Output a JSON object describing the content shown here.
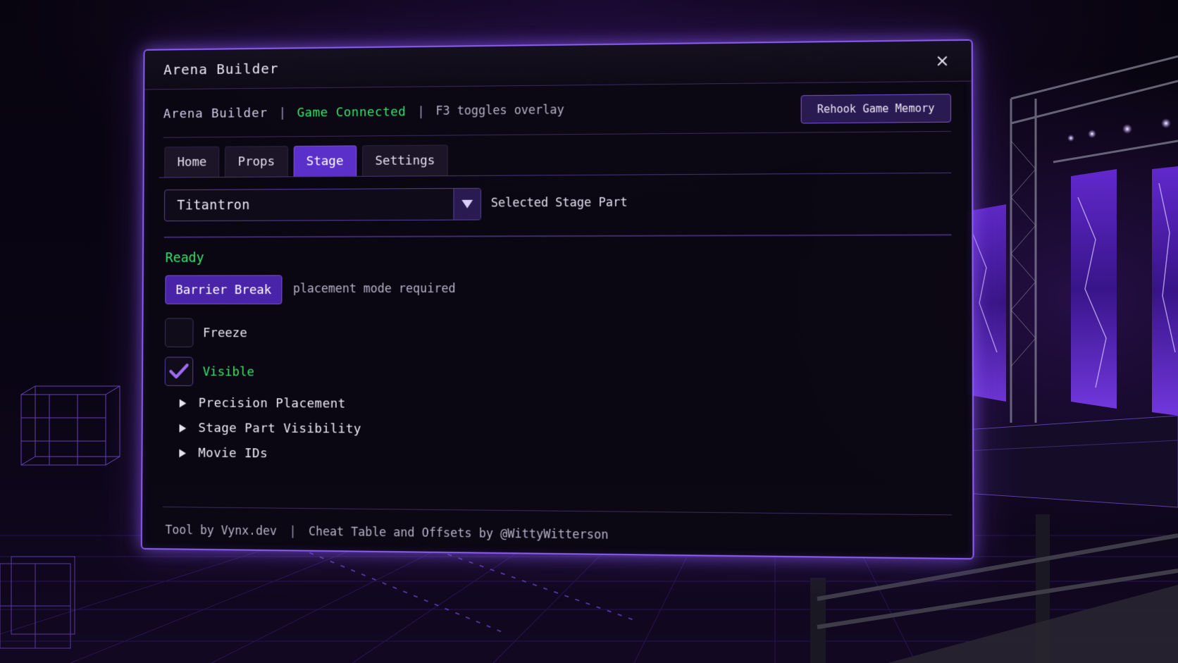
{
  "window": {
    "title": "Arena Builder",
    "close_icon": "close-icon"
  },
  "status": {
    "app_name": "Arena Builder",
    "separator": "|",
    "connection": "Game Connected",
    "hint": "F3 toggles overlay",
    "rehook_label": "Rehook Game Memory"
  },
  "tabs": [
    {
      "label": "Home",
      "active": false
    },
    {
      "label": "Props",
      "active": false
    },
    {
      "label": "Stage",
      "active": true
    },
    {
      "label": "Settings",
      "active": false
    }
  ],
  "stage": {
    "selected_part": "Titantron",
    "selected_part_label": "Selected Stage Part",
    "status": "Ready",
    "barrier_button": "Barrier Break",
    "barrier_hint": "placement mode required",
    "freeze_label": "Freeze",
    "freeze_checked": false,
    "visible_label": "Visible",
    "visible_checked": true,
    "sections": [
      {
        "label": "Precision Placement",
        "expanded": false
      },
      {
        "label": "Stage Part Visibility",
        "expanded": false
      },
      {
        "label": "Movie IDs",
        "expanded": false
      }
    ]
  },
  "footer": {
    "credit_tool": "Tool by Vynx.dev",
    "separator": "|",
    "credit_table": "Cheat Table and Offsets by @WittyWitterson"
  },
  "colors": {
    "accent": "#8b5cf6",
    "active_tab": "#5b2fc9",
    "success": "#34e36b",
    "background": "#05030c"
  }
}
